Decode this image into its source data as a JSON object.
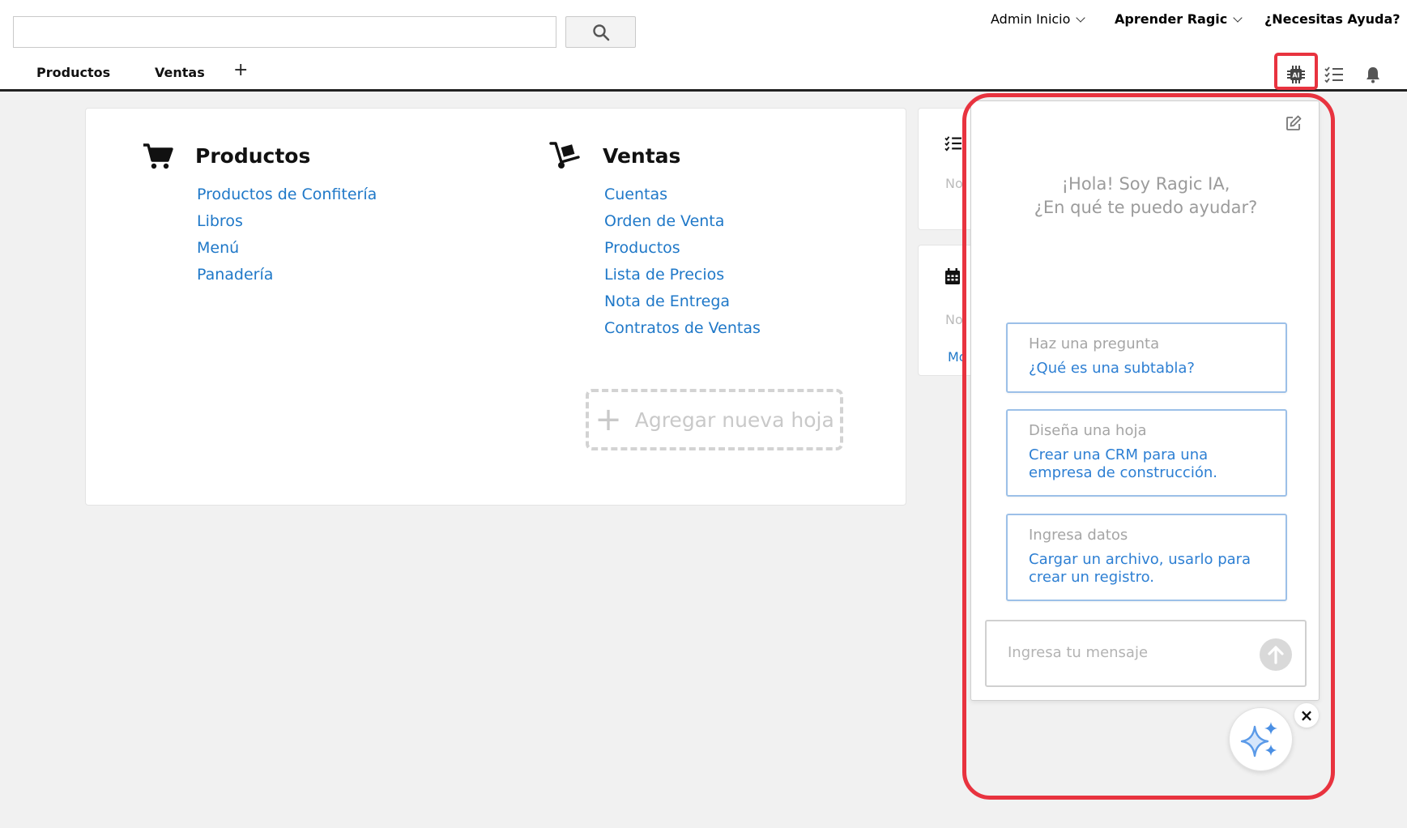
{
  "header": {
    "search": {
      "value": "",
      "placeholder": ""
    },
    "search_icon": "search-icon",
    "menu": [
      {
        "label": "Admin Inicio"
      },
      {
        "label": "Aprender Ragic"
      },
      {
        "label": "¿Necesitas Ayuda?"
      }
    ],
    "tabs": [
      {
        "label": "Productos"
      },
      {
        "label": "Ventas"
      }
    ],
    "add_tab_label": "+",
    "icons": [
      "ai-chip-icon",
      "task-list-icon",
      "bell-icon"
    ]
  },
  "main": {
    "sections": [
      {
        "title": "Productos",
        "icon": "cart-icon",
        "links": [
          "Productos de Confitería",
          "Libros",
          "Menú",
          "Panadería"
        ]
      },
      {
        "title": "Ventas",
        "icon": "hand-truck-icon",
        "links": [
          "Cuentas",
          "Orden de Venta",
          "Productos",
          "Lista de Precios",
          "Nota de Entrega",
          "Contratos de Ventas"
        ]
      }
    ],
    "add_sheet": {
      "plus": "+",
      "label": "Agregar nueva hoja"
    }
  },
  "side": {
    "card1_text": "No",
    "card2_text": "No",
    "card2_link": "Mo"
  },
  "ai_panel": {
    "greeting_line1": "¡Hola! Soy Ragic IA,",
    "greeting_line2": "¿En qué te puedo ayudar?",
    "suggestions": [
      {
        "title": "Haz una pregunta",
        "prompt": "¿Qué es una subtabla?"
      },
      {
        "title": "Diseña una hoja",
        "prompt": "Crear una CRM para una empresa de construcción."
      },
      {
        "title": "Ingresa datos",
        "prompt": "Cargar un archivo, usarlo para crear un registro."
      }
    ],
    "message": {
      "value": "",
      "placeholder": "Ingresa tu mensaje"
    },
    "close_label": "×"
  },
  "colors": {
    "link": "#1f78c8",
    "highlight": "#e8333f",
    "suggestion_border": "#9cc0e8"
  }
}
